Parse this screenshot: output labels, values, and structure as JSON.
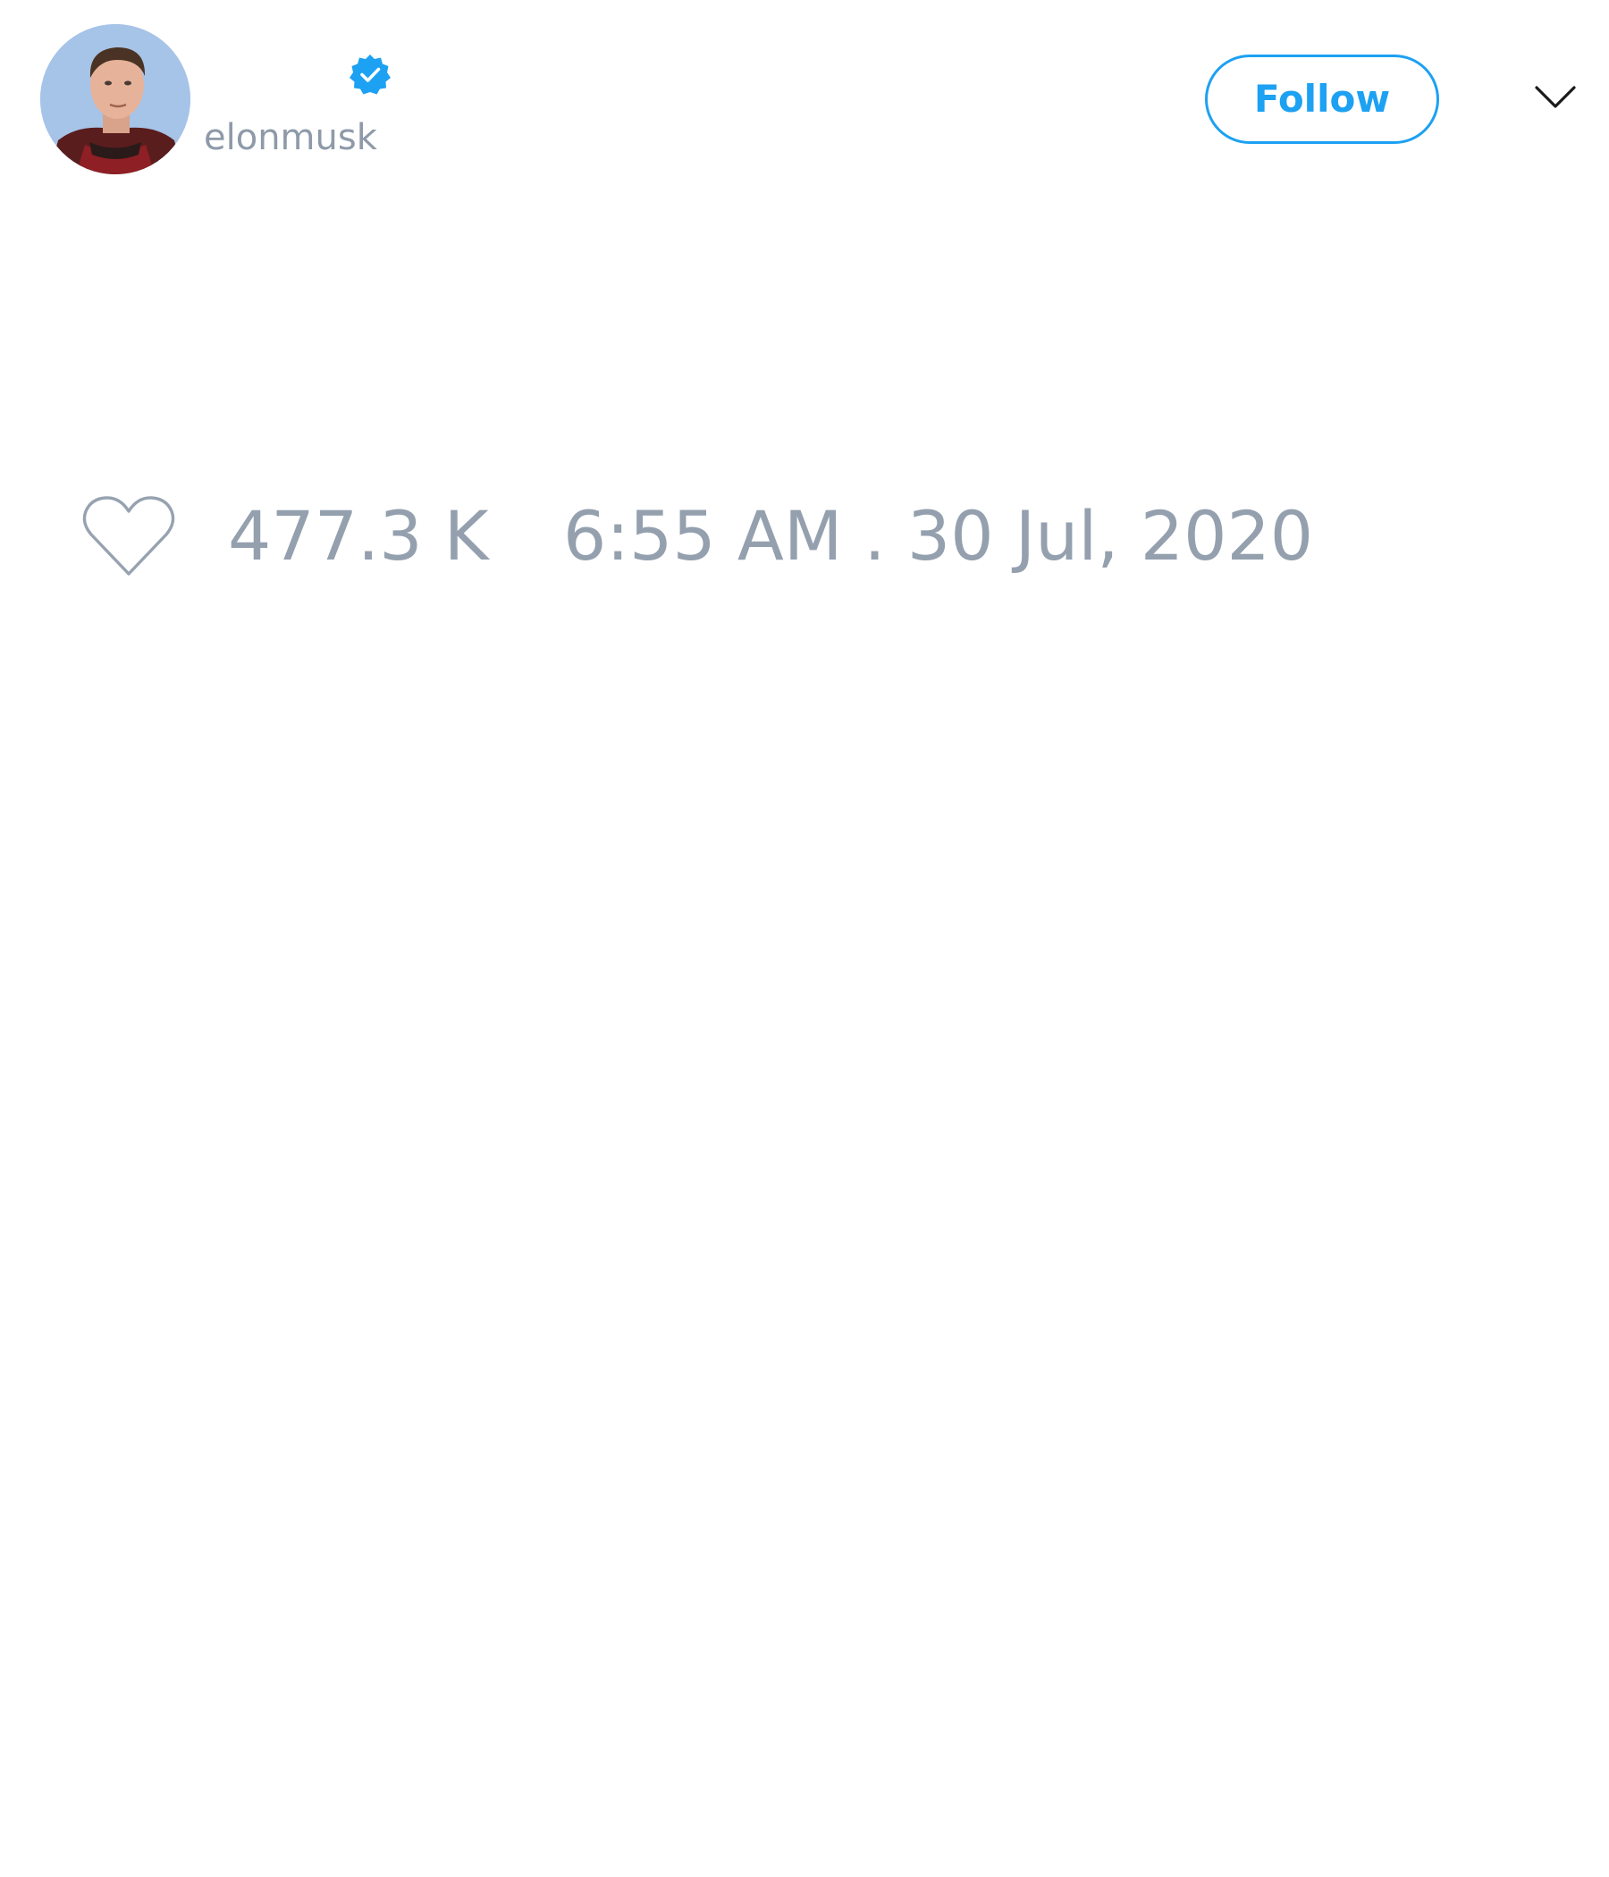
{
  "tweet": {
    "author": {
      "handle": "elonmusk",
      "verified": true,
      "avatar_icon": "profile-photo"
    },
    "follow_label": "Follow",
    "menu_icon": "chevron-down-icon",
    "likes": {
      "icon": "heart-outline-icon",
      "count": "477.3 K"
    },
    "timestamp": "6:55 AM . 30 Jul, 2020"
  },
  "colors": {
    "accent": "#1da1f2",
    "muted_text": "#94a0ae",
    "background": "#ffffff"
  }
}
